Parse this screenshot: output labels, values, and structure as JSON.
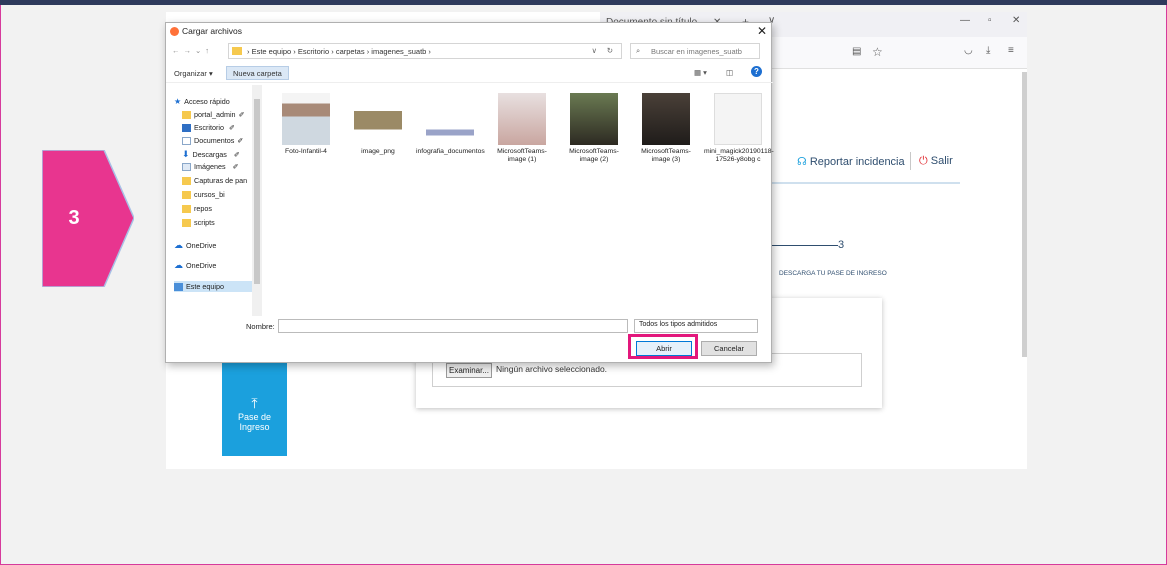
{
  "step": {
    "number": "3",
    "color": "#e8358f"
  },
  "browser": {
    "tab_title": "Documento sin título",
    "tab_close": "✕",
    "new_tab": "+",
    "tab_list": "∨",
    "min": "—",
    "max": "▫",
    "close": "✕"
  },
  "portal": {
    "report_label": "Reportar incidencia",
    "logout_label": "Salir",
    "step3_number": "3",
    "step3_label": "DESCARGA TU PASE DE INGRESO",
    "browse_label": "Examinar...",
    "no_file_label": "Ningún archivo seleccionado.",
    "pase_label": "Pase de Ingreso",
    "accent": "#1ba0dd"
  },
  "dialog": {
    "title": "Cargar archivos",
    "path": [
      "Este equipo",
      "Escritorio",
      "carpetas",
      "imagenes_suatb"
    ],
    "search_placeholder": "Buscar en imagenes_suatb",
    "organize_label": "Organizar ▾",
    "new_folder_label": "Nueva carpeta",
    "nav_items": [
      {
        "label": "Acceso rápido",
        "icon": "star-icon"
      },
      {
        "label": "portal_admin",
        "icon": "folder-icon"
      },
      {
        "label": "Escritorio",
        "icon": "desktop-icon"
      },
      {
        "label": "Documentos",
        "icon": "document-icon"
      },
      {
        "label": "Descargas",
        "icon": "download-icon"
      },
      {
        "label": "Imágenes",
        "icon": "image-icon"
      },
      {
        "label": "Capturas de pan",
        "icon": "folder-icon"
      },
      {
        "label": "cursos_bi",
        "icon": "folder-icon"
      },
      {
        "label": "repos",
        "icon": "folder-icon"
      },
      {
        "label": "scripts",
        "icon": "folder-icon"
      },
      {
        "label": "OneDrive",
        "icon": "cloud-icon"
      },
      {
        "label": "OneDrive",
        "icon": "cloud-icon"
      },
      {
        "label": "Este equipo",
        "icon": "computer-icon"
      }
    ],
    "files": [
      {
        "name": "Foto-Infantil-4"
      },
      {
        "name": "image_png"
      },
      {
        "name": "infografia_documentos"
      },
      {
        "name": "MicrosoftTeams-image (1)"
      },
      {
        "name": "MicrosoftTeams-image (2)"
      },
      {
        "name": "MicrosoftTeams-image (3)"
      },
      {
        "name": "mini_magick20190118-17526-y8obg c"
      }
    ],
    "name_label": "Nombre:",
    "name_value": "",
    "filter_value": "Todos los tipos admitidos",
    "open_label": "Abrir",
    "cancel_label": "Cancelar"
  },
  "colors": {
    "highlight": "#e3187c"
  }
}
